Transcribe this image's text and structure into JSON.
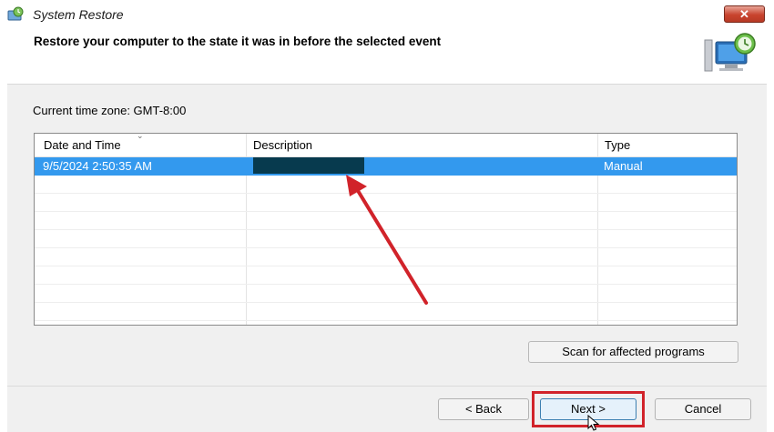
{
  "window": {
    "title": "System Restore",
    "close_label": "✕"
  },
  "header": {
    "title": "Restore your computer to the state it was in before the selected event"
  },
  "timezone": {
    "label": "Current time zone: GMT-8:00"
  },
  "table": {
    "columns": [
      "Date and Time",
      "Description",
      "Type"
    ],
    "rows": [
      {
        "date_time": "9/5/2024 2:50:35 AM",
        "description": "",
        "type": "Manual",
        "selected": true
      }
    ]
  },
  "buttons": {
    "scan": "Scan for affected programs",
    "back": "< Back",
    "next": "Next >",
    "cancel": "Cancel"
  },
  "colors": {
    "selection": "#3399ee",
    "annotation_red": "#d1232a",
    "redaction": "#073a4e"
  }
}
